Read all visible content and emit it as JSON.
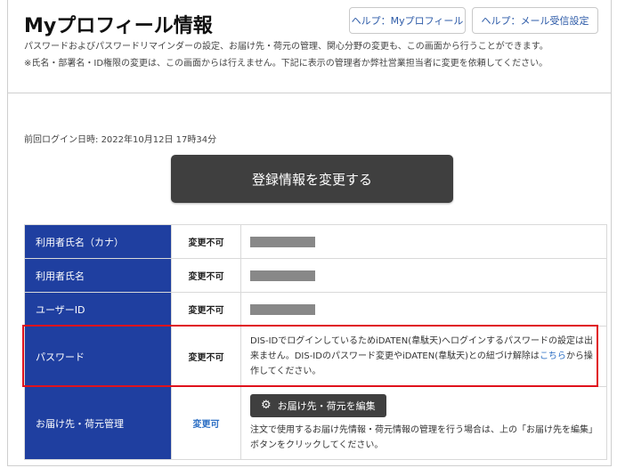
{
  "header": {
    "title": "Myプロフィール情報",
    "help_profile": "ヘルプ：Myプロフィール",
    "help_mail": "ヘルプ：メール受信設定"
  },
  "description": {
    "line1": "パスワードおよびパスワードリマインダーの設定、お届け先・荷元の管理、関心分野の変更も、この画面から行うことができます。",
    "line2": "※氏名・部署名・ID権限の変更は、この画面からは行えません。下記に表示の管理者か弊社営業担当者に変更を依頼してください。"
  },
  "last_login": {
    "label": "前回ログイン日時:",
    "value": "2022年10月12日 17時34分"
  },
  "main_button": "登録情報を変更する",
  "rows": [
    {
      "label": "利用者氏名（カナ）",
      "status": "変更不可"
    },
    {
      "label": "利用者氏名",
      "status": "変更不可"
    },
    {
      "label": "ユーザーID",
      "status": "変更不可"
    },
    {
      "label": "パスワード",
      "status": "変更不可",
      "text_pre": "DIS-IDでログインしているためiDATEN(韋駄天)へログインするパスワードの設定は出来ません。DIS-IDのパスワード変更やiDATEN(韋駄天)との紐づけ解除は",
      "link": "こちら",
      "text_post": "から操作してください。"
    },
    {
      "label": "お届け先・荷元管理",
      "status": "変更可",
      "button": "お届け先・荷元を編集",
      "note": "注文で使用するお届け先情報・荷元情報の管理を行う場合は、上の「お届け先を編集」ボタンをクリックしてください。"
    }
  ],
  "colors": {
    "label_bg": "#1f3fa0",
    "highlight": "#e0121c",
    "link": "#2d6fc4",
    "button_bg": "#3f3f3f"
  }
}
